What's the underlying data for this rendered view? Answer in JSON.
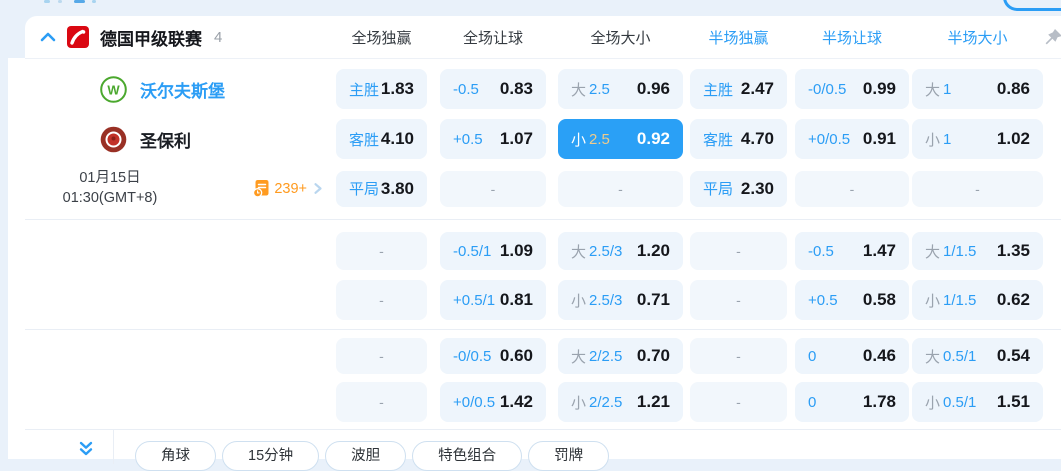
{
  "header": {
    "league": "德国甲级联赛",
    "count": "4",
    "cols": [
      "全场独赢",
      "全场让球",
      "全场大小",
      "半场独赢",
      "半场让球",
      "半场大小"
    ]
  },
  "match": {
    "home": "沃尔夫斯堡",
    "away": "圣保利",
    "date": "01月15日",
    "time": "01:30(GMT+8)",
    "markets_count": "239+"
  },
  "odds": {
    "dash": "-",
    "s1": {
      "home": {
        "c1": {
          "l": "主胜",
          "v": "1.83"
        },
        "c2": {
          "l": "-0.5",
          "v": "0.83"
        },
        "c3": {
          "g": "大",
          "l": "2.5",
          "v": "0.96"
        },
        "c4": {
          "l": "主胜",
          "v": "2.47"
        },
        "c5": {
          "l": "-0/0.5",
          "v": "0.99"
        },
        "c6": {
          "g": "大",
          "l": "1",
          "v": "0.86"
        }
      },
      "away": {
        "c1": {
          "l": "客胜",
          "v": "4.10"
        },
        "c2": {
          "l": "+0.5",
          "v": "1.07"
        },
        "c3": {
          "g": "小",
          "l": "2.5",
          "v": "0.92"
        },
        "c4": {
          "l": "客胜",
          "v": "4.70"
        },
        "c5": {
          "l": "+0/0.5",
          "v": "0.91"
        },
        "c6": {
          "g": "小",
          "l": "1",
          "v": "1.02"
        }
      },
      "draw": {
        "c1": {
          "l": "平局",
          "v": "3.80"
        },
        "c4": {
          "l": "平局",
          "v": "2.30"
        }
      }
    },
    "s2": {
      "r1": {
        "c2": {
          "l": "-0.5/1",
          "v": "1.09"
        },
        "c3": {
          "g": "大",
          "l": "2.5/3",
          "v": "1.20"
        },
        "c5": {
          "l": "-0.5",
          "v": "1.47"
        },
        "c6": {
          "g": "大",
          "l": "1/1.5",
          "v": "1.35"
        }
      },
      "r2": {
        "c2": {
          "l": "+0.5/1",
          "v": "0.81"
        },
        "c3": {
          "g": "小",
          "l": "2.5/3",
          "v": "0.71"
        },
        "c5": {
          "l": "+0.5",
          "v": "0.58"
        },
        "c6": {
          "g": "小",
          "l": "1/1.5",
          "v": "0.62"
        }
      }
    },
    "s3": {
      "r1": {
        "c2": {
          "l": "-0/0.5",
          "v": "0.60"
        },
        "c3": {
          "g": "大",
          "l": "2/2.5",
          "v": "0.70"
        },
        "c5": {
          "l": "0",
          "v": "0.46"
        },
        "c6": {
          "g": "大",
          "l": "0.5/1",
          "v": "0.54"
        }
      },
      "r2": {
        "c2": {
          "l": "+0/0.5",
          "v": "1.42"
        },
        "c3": {
          "g": "小",
          "l": "2/2.5",
          "v": "1.21"
        },
        "c5": {
          "l": "0",
          "v": "1.78"
        },
        "c6": {
          "g": "小",
          "l": "0.5/1",
          "v": "1.51"
        }
      }
    }
  },
  "footer": {
    "tabs": [
      "角球",
      "15分钟",
      "波胆",
      "特色组合",
      "罚牌"
    ]
  },
  "colors": {
    "accent": "#2b9df5",
    "selected_bg": "#2aa0f6",
    "selected_gold": "#eecb8d",
    "orange": "#ff9a1e"
  }
}
